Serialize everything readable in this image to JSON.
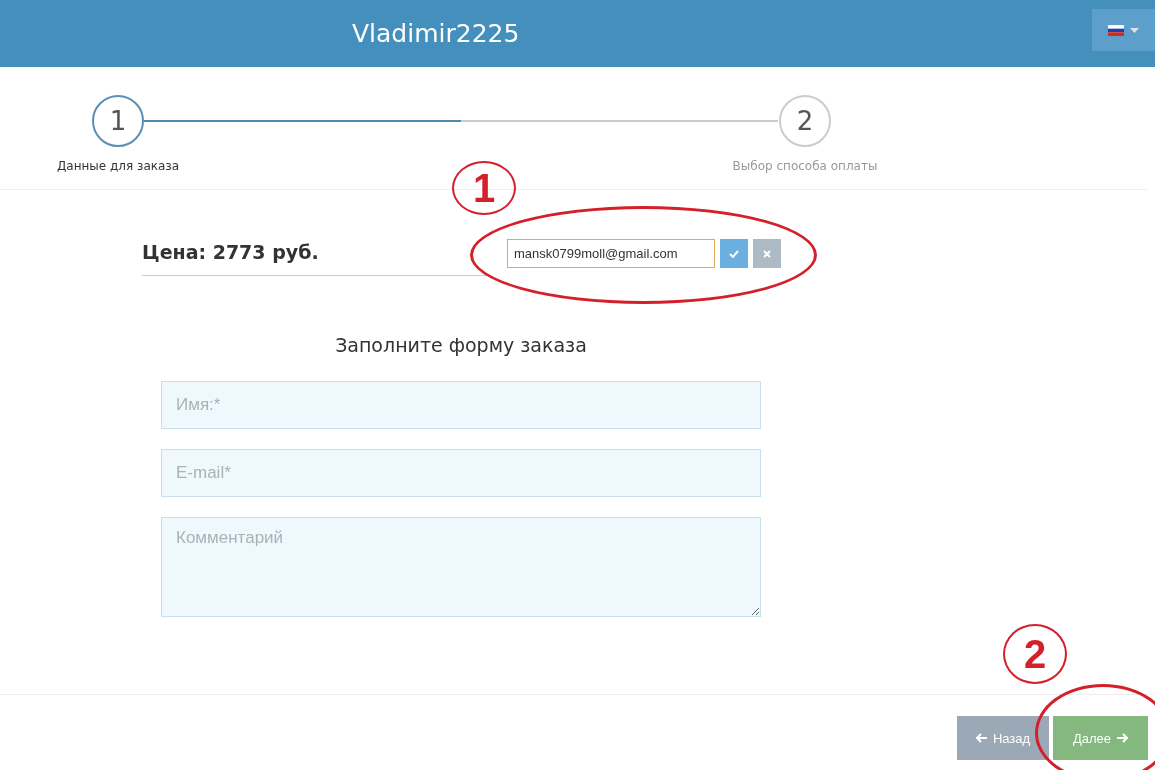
{
  "header": {
    "title": "Vladimir2225",
    "language_button": {
      "expanded": false
    }
  },
  "steps": [
    {
      "number": "1",
      "label": "Данные для заказа",
      "selected": true
    },
    {
      "number": "2",
      "label": "Выбор способа оплаты",
      "selected": false
    }
  ],
  "progress": {
    "level": 0.5
  },
  "price": {
    "text": "Цена: 2773 руб."
  },
  "email_edit": {
    "value": "mansk0799moll@gmail.com"
  },
  "form": {
    "title": "Заполните форму заказа",
    "fields": [
      {
        "kind": "input",
        "placeholder": "Имя:*"
      },
      {
        "kind": "input",
        "placeholder": "E-mail*"
      },
      {
        "kind": "textarea",
        "placeholder": "Комментарий"
      }
    ]
  },
  "footer": {
    "buttons": [
      {
        "kind": "back",
        "label": "Назад"
      },
      {
        "kind": "next",
        "label": "Далее"
      }
    ]
  },
  "annotations": [
    {
      "label": "1"
    },
    {
      "label": "2"
    }
  ]
}
